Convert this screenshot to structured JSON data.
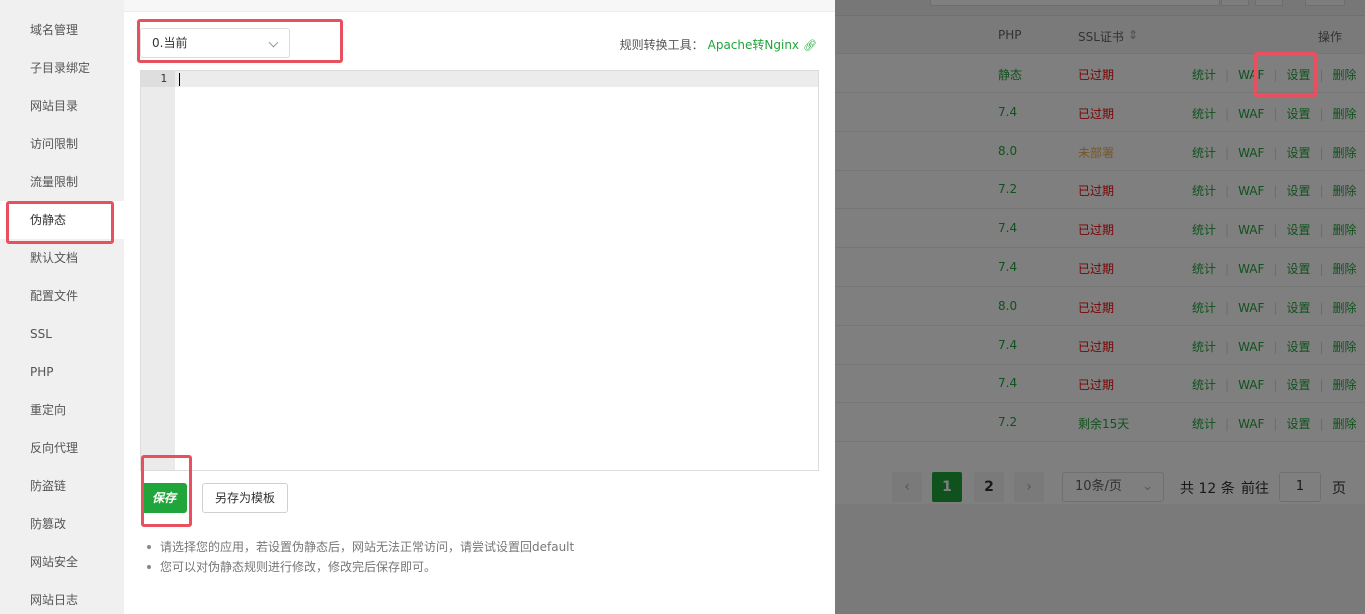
{
  "sidebar": {
    "items": [
      {
        "label": "域名管理"
      },
      {
        "label": "子目录绑定"
      },
      {
        "label": "网站目录"
      },
      {
        "label": "访问限制"
      },
      {
        "label": "流量限制"
      },
      {
        "label": "伪静态"
      },
      {
        "label": "默认文档"
      },
      {
        "label": "配置文件"
      },
      {
        "label": "SSL"
      },
      {
        "label": "PHP"
      },
      {
        "label": "重定向"
      },
      {
        "label": "反向代理"
      },
      {
        "label": "防盗链"
      },
      {
        "label": "防篡改"
      },
      {
        "label": "网站安全"
      },
      {
        "label": "网站日志"
      }
    ],
    "active": "伪静态"
  },
  "panel": {
    "select_value": "0.当前",
    "tool_label": "规则转换工具：",
    "tool_link": "Apache转Nginx",
    "line_number": "1",
    "editor_content": "",
    "save_label": "保存",
    "save_template_label": "另存为模板",
    "tips": [
      "请选择您的应用，若设置伪静态后，网站无法正常访问，请尝试设置回default",
      "您可以对伪静态规则进行修改，修改完后保存即可。"
    ]
  },
  "background_table": {
    "headers": {
      "php": "PHP",
      "ssl": "SSL证书",
      "sort_icon": "⇕",
      "ops": "操作"
    },
    "rows": [
      {
        "php": "静态",
        "ssl": "已过期",
        "ssl_status": "expired"
      },
      {
        "php": "7.4",
        "ssl": "已过期",
        "ssl_status": "expired"
      },
      {
        "php": "8.0",
        "ssl": "未部署",
        "ssl_status": "undeployed"
      },
      {
        "php": "7.2",
        "ssl": "已过期",
        "ssl_status": "expired"
      },
      {
        "php": "7.4",
        "ssl": "已过期",
        "ssl_status": "expired"
      },
      {
        "php": "7.4",
        "ssl": "已过期",
        "ssl_status": "expired"
      },
      {
        "php": "8.0",
        "ssl": "已过期",
        "ssl_status": "expired"
      },
      {
        "php": "7.4",
        "ssl": "已过期",
        "ssl_status": "expired"
      },
      {
        "php": "7.4",
        "ssl": "已过期",
        "ssl_status": "expired"
      },
      {
        "php": "7.2",
        "ssl": "剩余15天",
        "ssl_status": "remaining"
      }
    ],
    "row_actions": {
      "stats": "统计",
      "waf": "WAF",
      "settings": "设置",
      "delete": "删除"
    },
    "pagination": {
      "prev": "‹",
      "pages": [
        "1",
        "2"
      ],
      "current_page": "1",
      "next": "›",
      "page_size": "10条/页",
      "total": "共 12 条",
      "goto_label": "前往",
      "goto_value": "1",
      "page_suffix": "页"
    }
  },
  "colors": {
    "accent": "#20a53a",
    "expired": "#ef0808",
    "undeployed": "#f0ad4e",
    "highlight": "#e8505f"
  }
}
